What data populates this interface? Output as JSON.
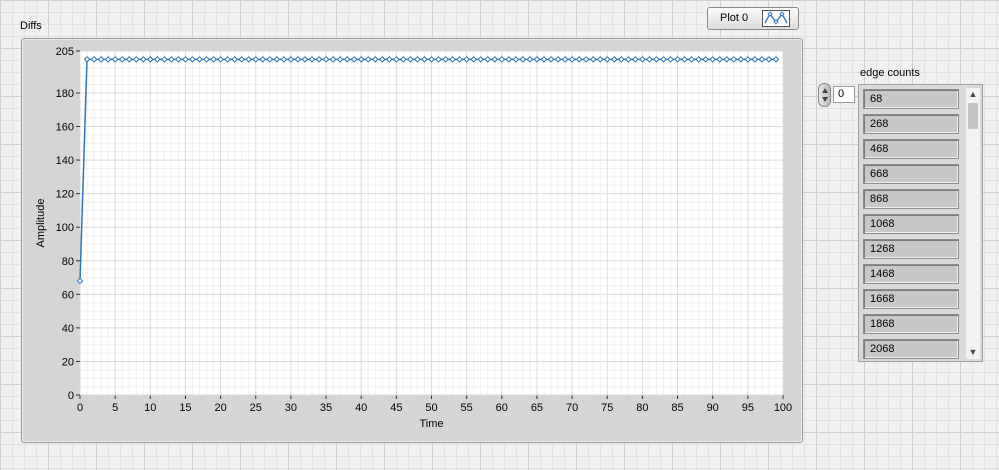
{
  "graph": {
    "label": "Diffs",
    "legend_label": "Plot 0",
    "legend_icon": "waveform-icon"
  },
  "array": {
    "label": "edge counts",
    "index_value": "0",
    "items": [
      "68",
      "268",
      "468",
      "668",
      "868",
      "1068",
      "1268",
      "1468",
      "1668",
      "1868",
      "2068"
    ]
  },
  "colors": {
    "plot_line": "#2f75b5",
    "plot_area": "#ffffff",
    "frame": "#d5d5d5"
  },
  "chart_data": {
    "type": "line",
    "xlabel": "Time",
    "ylabel": "Amplitude",
    "xlim": [
      0,
      100
    ],
    "ylim": [
      0,
      205
    ],
    "x_ticks": [
      0,
      5,
      10,
      15,
      20,
      25,
      30,
      35,
      40,
      45,
      50,
      55,
      60,
      65,
      70,
      75,
      80,
      85,
      90,
      95,
      100
    ],
    "y_ticks": [
      0,
      20,
      40,
      60,
      80,
      100,
      120,
      140,
      160,
      180,
      205
    ],
    "grid": true,
    "markers": "diamond",
    "series": [
      {
        "x": [
          0,
          1,
          2,
          3,
          4,
          5,
          6,
          7,
          8,
          9,
          10,
          11,
          12,
          13,
          14,
          15,
          16,
          17,
          18,
          19,
          20,
          21,
          22,
          23,
          24,
          25,
          26,
          27,
          28,
          29,
          30,
          31,
          32,
          33,
          34,
          35,
          36,
          37,
          38,
          39,
          40,
          41,
          42,
          43,
          44,
          45,
          46,
          47,
          48,
          49,
          50,
          51,
          52,
          53,
          54,
          55,
          56,
          57,
          58,
          59,
          60,
          61,
          62,
          63,
          64,
          65,
          66,
          67,
          68,
          69,
          70,
          71,
          72,
          73,
          74,
          75,
          76,
          77,
          78,
          79,
          80,
          81,
          82,
          83,
          84,
          85,
          86,
          87,
          88,
          89,
          90,
          91,
          92,
          93,
          94,
          95,
          96,
          97,
          98,
          99
        ],
        "values": [
          68,
          200,
          200,
          200,
          200,
          200,
          200,
          200,
          200,
          200,
          200,
          200,
          200,
          200,
          200,
          200,
          200,
          200,
          200,
          200,
          200,
          200,
          200,
          200,
          200,
          200,
          200,
          200,
          200,
          200,
          200,
          200,
          200,
          200,
          200,
          200,
          200,
          200,
          200,
          200,
          200,
          200,
          200,
          200,
          200,
          200,
          200,
          200,
          200,
          200,
          200,
          200,
          200,
          200,
          200,
          200,
          200,
          200,
          200,
          200,
          200,
          200,
          200,
          200,
          200,
          200,
          200,
          200,
          200,
          200,
          200,
          200,
          200,
          200,
          200,
          200,
          200,
          200,
          200,
          200,
          200,
          200,
          200,
          200,
          200,
          200,
          200,
          200,
          200,
          200,
          200,
          200,
          200,
          200,
          200,
          200,
          200,
          200,
          200,
          200
        ]
      }
    ]
  }
}
